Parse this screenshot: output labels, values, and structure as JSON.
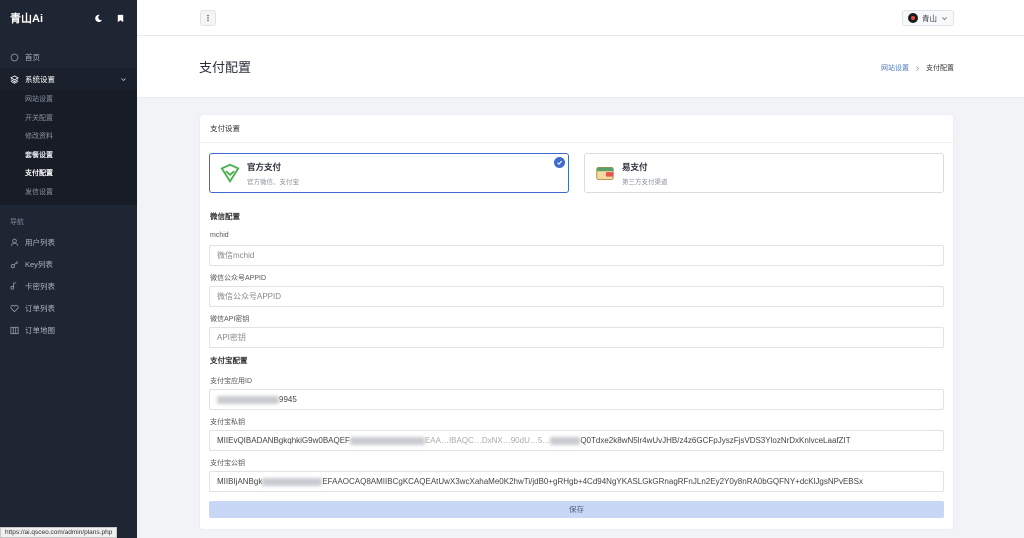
{
  "sidebar": {
    "title": "青山Ai",
    "items_top": [
      {
        "label": "首页",
        "icon": "home-icon"
      },
      {
        "label": "系统设置",
        "icon": "layers-icon"
      }
    ],
    "sub_items": [
      "网站设置",
      "开关配置",
      "修改资料",
      "套餐设置",
      "支付配置",
      "发信设置"
    ],
    "section_label": "导航",
    "nav_items": [
      {
        "label": "用户列表",
        "icon": "user-icon"
      },
      {
        "label": "Key列表",
        "icon": "key-icon"
      },
      {
        "label": "卡密列表",
        "icon": "ticket-icon"
      },
      {
        "label": "订单列表",
        "icon": "heart-icon"
      },
      {
        "label": "订单地图",
        "icon": "map-icon"
      }
    ]
  },
  "topbar": {
    "user_name": "青山"
  },
  "page": {
    "title": "支付配置",
    "breadcrumb_link": "网站设置",
    "breadcrumb_current": "支付配置"
  },
  "card": {
    "title": "支付设置",
    "options": [
      {
        "name": "官方支付",
        "desc": "官方微信、支付宝",
        "selected": true
      },
      {
        "name": "易支付",
        "desc": "第三方支付渠道",
        "selected": false
      }
    ],
    "wechat_section": "微信配置",
    "fields_wechat": [
      {
        "label": "mchid",
        "placeholder": "微信mchid"
      },
      {
        "label": "微信公众号APPID",
        "placeholder": "微信公众号APPID"
      },
      {
        "label": "微信API密钥",
        "placeholder": "API密钥"
      }
    ],
    "alipay_section": "支付宝配置",
    "alipay_appid_label": "支付宝应用ID",
    "alipay_appid_suffix": "9945",
    "alipay_private_label": "支付宝私钥",
    "alipay_private_start": "MIIEvQIBADANBgkqhkiG9w0BAQEF",
    "alipay_private_mid": "EAA…IBAQC…DxNX…90dU…5…",
    "alipay_private_end": "Q0Tdxe2k8wN5lr4wUvJHB/z4z6GCFpJyszFjsVDS3YlozNrDxKnlvceLaafZIT",
    "alipay_public_label": "支付宝公钥",
    "alipay_public_start": "MIIBIjANBgk",
    "alipay_public_end": "EFAAOCAQ8AMIIBCgKCAQEAtUwX3wcXahaMe0K2hwTi/jdB0+gRHgb+4Cd94NgYKASLGkGRnagRFnJLn2Ey2Y0y8nRA0bGQFNY+dcKlJgsNPvEBSx",
    "save_label": "保存"
  },
  "status_url": "https://ai.qsceo.com/admin/plans.php",
  "colors": {
    "sidebar": "#1e2533",
    "accent": "#3f6bd1",
    "save_bg": "#c7d7f5"
  }
}
